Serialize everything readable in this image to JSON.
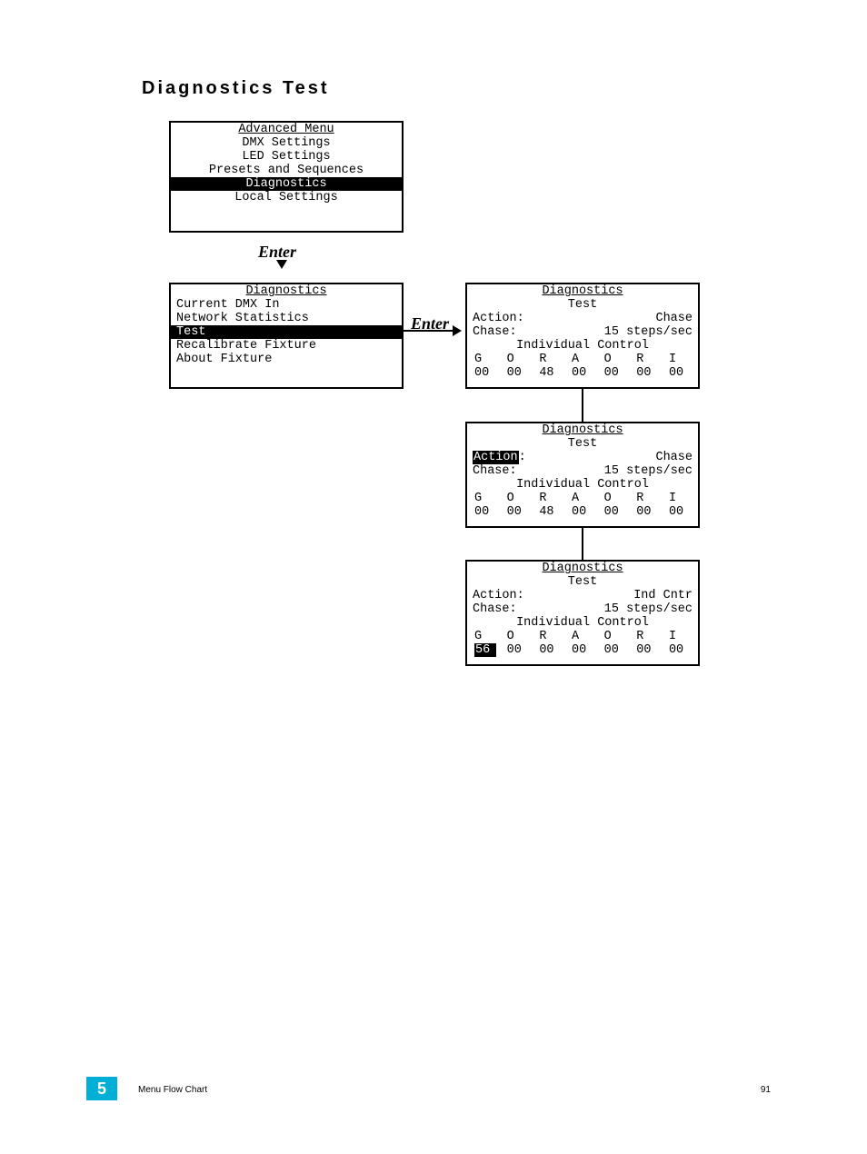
{
  "page": {
    "title": "Diagnostics Test",
    "chapter_number": "5",
    "footer_label": "Menu Flow Chart",
    "page_number": "91"
  },
  "enter_label": "Enter",
  "screen1": {
    "title": "Advanced Menu",
    "items": [
      "DMX Settings",
      "LED Settings",
      "Presets and Sequences",
      "Diagnostics",
      "Local Settings"
    ],
    "highlight_index": 3
  },
  "screen2": {
    "title": "Diagnostics",
    "items": [
      "Current DMX In",
      "Network Statistics",
      "Test",
      "Recalibrate Fixture",
      "About Fixture"
    ],
    "highlight_index": 2
  },
  "test_common": {
    "title": "Diagnostics",
    "subtitle": "Test",
    "action_label": "Action:",
    "chase_label": "Chase:",
    "chase_rate": "15 steps/sec",
    "ind_ctrl_label": "Individual Control",
    "col_headers": [
      "G",
      "O",
      "R",
      "A",
      "O",
      "R",
      "I"
    ]
  },
  "screen3": {
    "action_value": "Chase",
    "values": [
      "00",
      "00",
      "48",
      "00",
      "00",
      "00",
      "00"
    ],
    "highlight": null
  },
  "screen4": {
    "action_value": "Chase",
    "values": [
      "00",
      "00",
      "48",
      "00",
      "00",
      "00",
      "00"
    ],
    "highlight": "action"
  },
  "screen5": {
    "action_value": "Ind Cntr",
    "values": [
      "56",
      "00",
      "00",
      "00",
      "00",
      "00",
      "00"
    ],
    "highlight": "val0"
  }
}
